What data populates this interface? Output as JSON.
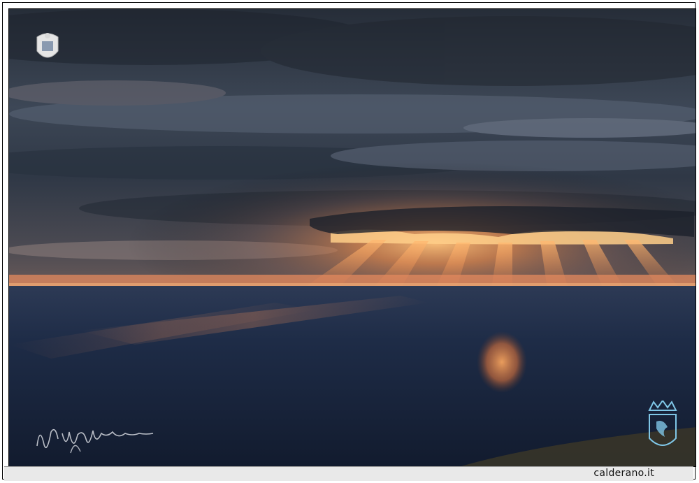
{
  "footer": {
    "site_credit": "calderano.it"
  },
  "image": {
    "watermark_logo_top_left": "crest-emblem-icon",
    "watermark_logo_bottom_right": "coat-of-arms-icon",
    "signature": "handwritten-signature"
  },
  "colors": {
    "sky_dark": "#2b3340",
    "sky_mid": "#4a5566",
    "sun_glow": "#f2a55a",
    "horizon": "#e4805a",
    "sea_dark": "#1a2840",
    "sea_reflection": "#e3864a",
    "logo_blue": "#7fc6e6"
  }
}
